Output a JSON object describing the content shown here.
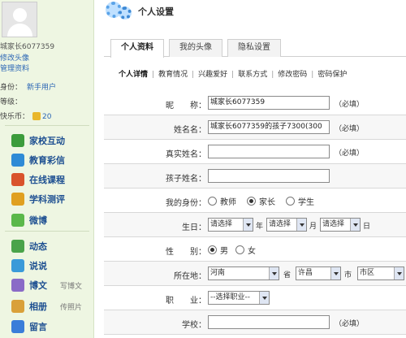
{
  "sidebar": {
    "username": "城家长6077359",
    "link1": "修改头像",
    "link2": "管理资料",
    "identity_label": "身份：",
    "identity_value": "新手用户",
    "level_label": "等级：",
    "level_value": "",
    "coins_label": "快乐币：",
    "coins_value": "20",
    "nav": [
      {
        "label": "家校互动",
        "icon": "home-school-icon",
        "color": "#3c9c3c"
      },
      {
        "label": "教育彩信",
        "icon": "message-icon",
        "color": "#2f8bd6"
      },
      {
        "label": "在线课程",
        "icon": "course-icon",
        "color": "#d9532c"
      },
      {
        "label": "学科测评",
        "icon": "test-icon",
        "color": "#e0a020"
      },
      {
        "label": "微博",
        "icon": "weibo-icon",
        "color": "#5bb84a"
      },
      {
        "label": "动态",
        "icon": "activity-icon",
        "color": "#4aa34a"
      },
      {
        "label": "说说",
        "icon": "chat-icon",
        "color": "#3a9ad9"
      },
      {
        "label": "博文",
        "icon": "blog-icon",
        "color": "#8a6bc7",
        "extra": "写博文"
      },
      {
        "label": "相册",
        "icon": "album-icon",
        "color": "#d9a03a",
        "extra": "传照片"
      },
      {
        "label": "留言",
        "icon": "guestbook-icon",
        "color": "#3a7dd9"
      }
    ]
  },
  "header": {
    "title": "个人设置"
  },
  "tabs": [
    "个人资料",
    "我的头像",
    "隐私设置"
  ],
  "subnav": [
    "个人详情",
    "教育情况",
    "兴趣爱好",
    "联系方式",
    "修改密码",
    "密码保护"
  ],
  "form": {
    "required_text": "（必填）",
    "nickname": {
      "label": "昵　　称：",
      "value": "城家长6077359"
    },
    "realname": {
      "label": "姓名名：",
      "value": "城家长6077359的孩子7300(300"
    },
    "truename": {
      "label": "真实姓名：",
      "value": ""
    },
    "childname": {
      "label": "孩子姓名：",
      "value": ""
    },
    "identity": {
      "label": "我的身份：",
      "options": [
        "教师",
        "家长",
        "学生"
      ],
      "selected": 1
    },
    "birthday": {
      "label": "生日：",
      "year": "请选择",
      "month": "请选择",
      "day": "请选择",
      "unit_year": "年",
      "unit_month": "月",
      "unit_day": "日"
    },
    "gender": {
      "label": "性　　别：",
      "options": [
        "男",
        "女"
      ],
      "selected": 0
    },
    "location": {
      "label": "所在地：",
      "province": "河南",
      "unit_province": "省",
      "city": "许昌",
      "unit_city": "市",
      "district": "市区"
    },
    "job": {
      "label": "职　　业：",
      "value": "--选择职业--"
    },
    "school": {
      "label": "学校：",
      "value": ""
    }
  }
}
